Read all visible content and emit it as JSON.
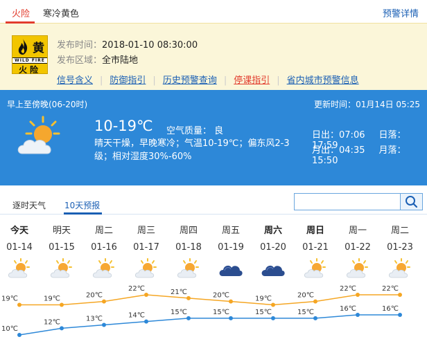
{
  "top_tabs": [
    {
      "label": "火险",
      "active": true
    },
    {
      "label": "寒冷黄色",
      "active": false
    }
  ],
  "warning_details_link": "预警详情",
  "warning": {
    "badge_char": "黄",
    "badge_en": "WILD FIRE",
    "badge_cn": "火险",
    "publish_time_label": "发布时间：",
    "publish_time": "2018-01-10 08:30:00",
    "region_label": "发布区域：",
    "region": "全市陆地",
    "links": [
      {
        "label": "信号含义",
        "red": false
      },
      {
        "label": "防御指引",
        "red": false
      },
      {
        "label": "历史预警查询",
        "red": false
      },
      {
        "label": "停课指引",
        "red": true
      },
      {
        "label": "省内城市预警信息",
        "red": false
      }
    ]
  },
  "current": {
    "period": "早上至傍晚(06-20时)",
    "update_label": "更新时间：",
    "update_time": "01月14日 05:25",
    "temp_range": "10-19℃",
    "air_quality_label": "空气质量：",
    "air_quality": "良",
    "description": "晴天干燥，早晚寒冷；气温10-19℃；偏东风2-3级；相对湿度30%-60%",
    "sunrise_label": "日出：",
    "sunrise": "07:06",
    "sunset_label": "日落：",
    "sunset": "17:59",
    "moonrise_label": "月出：",
    "moonrise": "04:35",
    "moonset_label": "月落：",
    "moonset": "15:50"
  },
  "forecast_tabs": [
    {
      "label": "逐时天气",
      "active": false
    },
    {
      "label": "10天预报",
      "active": true
    }
  ],
  "search": {
    "placeholder": ""
  },
  "chart_data": {
    "type": "line",
    "categories": [
      "01-14",
      "01-15",
      "01-16",
      "01-17",
      "01-18",
      "01-19",
      "01-20",
      "01-21",
      "01-22",
      "01-23"
    ],
    "day_names": [
      "今天",
      "明天",
      "周二",
      "周三",
      "周四",
      "周五",
      "周六",
      "周日",
      "周一",
      "周二"
    ],
    "bold_days": [
      true,
      false,
      false,
      false,
      false,
      false,
      true,
      true,
      false,
      false
    ],
    "icons": [
      "sun-cloud",
      "sun-cloud",
      "sun-cloud",
      "sun-cloud",
      "sun-cloud",
      "cloud",
      "cloud",
      "sun-cloud",
      "sun-cloud",
      "sun-cloud"
    ],
    "series": [
      {
        "values": [
          19,
          19,
          20,
          22,
          21,
          20,
          19,
          20,
          22,
          22
        ],
        "color": "#f5a623"
      },
      {
        "values": [
          10,
          12,
          13,
          14,
          15,
          15,
          15,
          15,
          16,
          16
        ],
        "color": "#2d88d8"
      }
    ],
    "unit": "℃"
  }
}
